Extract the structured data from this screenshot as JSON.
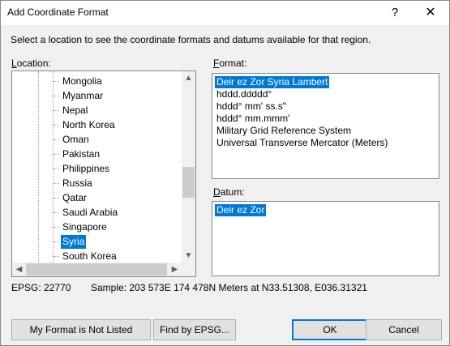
{
  "window": {
    "title": "Add Coordinate Format",
    "help_label": "?",
    "close_label": "✕"
  },
  "instruction": "Select a location to see the coordinate formats and datums available for that region.",
  "location": {
    "label": "Location:",
    "items": [
      "Mongolia",
      "Myanmar",
      "Nepal",
      "North Korea",
      "Oman",
      "Pakistan",
      "Philippines",
      "Russia",
      "Qatar",
      "Saudi Arabia",
      "Singapore",
      "Syria",
      "South Korea"
    ],
    "selected": "Syria",
    "scroll_up": "▲",
    "scroll_down": "▼",
    "scroll_left": "◀",
    "scroll_right": "▶"
  },
  "format": {
    "label": "Format:",
    "items": [
      "Deir ez Zor Syria Lambert",
      "hddd.ddddd°",
      "hddd° mm' ss.s\"",
      "hddd° mm.mmm'",
      "Military Grid Reference System",
      "Universal Transverse Mercator (Meters)"
    ],
    "selected": "Deir ez Zor Syria Lambert"
  },
  "datum": {
    "label": "Datum:",
    "items": [
      "Deir ez Zor"
    ],
    "selected": "Deir ez Zor"
  },
  "status": {
    "epsg": "EPSG: 22770",
    "sample": "Sample: 203 573E  174 478N Meters at N33.51308, E036.31321"
  },
  "buttons": {
    "not_listed": "My Format is Not Listed",
    "find_epsg": "Find by EPSG...",
    "ok": "OK",
    "cancel": "Cancel"
  }
}
